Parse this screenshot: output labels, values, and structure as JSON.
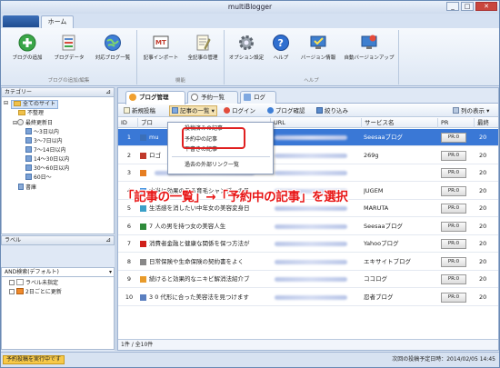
{
  "window": {
    "title": "multiBlogger",
    "minimize": "_",
    "maximize": "□",
    "close": "✕"
  },
  "ribbon": {
    "home_tab": "ホーム",
    "groups": [
      {
        "label": "ブログの追加/編集",
        "buttons": [
          "ブログの追加",
          "ブログデータ",
          "対応ブログ一覧"
        ]
      },
      {
        "label": "機能",
        "buttons": [
          "記事インポート",
          "全記事の管理"
        ]
      },
      {
        "label": "ヘルプ",
        "buttons": [
          "オプション設定",
          "ヘルプ",
          "バージョン情報",
          "自動バージョンアップ"
        ]
      }
    ]
  },
  "category_panel": {
    "header": "カテゴリー",
    "root": "全てのサイト",
    "items": [
      "不整理",
      "最終更新日",
      "～3日以内",
      "3～7日以内",
      "7～14日以内",
      "14～30日以内",
      "30～60日以内",
      "60日～",
      "書庫"
    ]
  },
  "label_panel": {
    "header": "ラベル",
    "mode": "AND検索(デフォルト)",
    "items": [
      "ラベル未指定",
      "2日ごとに更新"
    ]
  },
  "tabs": [
    "ブログ管理",
    "予約一覧",
    "ログ"
  ],
  "toolbar": {
    "new_post": "新規投稿",
    "post_list": "記事の一覧",
    "login": "ログイン",
    "blog_confirm": "ブログ確認",
    "filter": "絞り込み",
    "columns": "列の表示"
  },
  "table": {
    "headers": [
      "ID",
      "ブロ",
      "URL",
      "サービス名",
      "PR",
      "最終"
    ],
    "rows": [
      {
        "id": "1",
        "title": "mu",
        "service": "Seesaaブログ",
        "pr": "PR:0",
        "last": "20"
      },
      {
        "id": "2",
        "title": "ロゴ",
        "service": "269g",
        "pr": "PR:0",
        "last": "20"
      },
      {
        "id": "3",
        "title": "",
        "service": "",
        "pr": "PR:0",
        "last": "20"
      },
      {
        "id": "4",
        "title": "本当に効果のある育毛シャンプーの見",
        "service": "JUGEM",
        "pr": "PR:0",
        "last": "20"
      },
      {
        "id": "5",
        "title": "生活感を消したい中年女の美容変身日",
        "service": "MARUTA",
        "pr": "PR:0",
        "last": "20"
      },
      {
        "id": "6",
        "title": "7 人の男を持つ女の美容人生",
        "service": "Seesaaブログ",
        "pr": "PR:0",
        "last": "20"
      },
      {
        "id": "7",
        "title": "消費者金融と健康な関係を保つ方法が",
        "service": "Yahooブログ",
        "pr": "PR:0",
        "last": "20"
      },
      {
        "id": "8",
        "title": "日常保険や生命保険の契約書をよく",
        "service": "エキサイトブログ",
        "pr": "PR:0",
        "last": "20"
      },
      {
        "id": "9",
        "title": "続けると効果的なニキビ解消法紹介ブ",
        "service": "ココログ",
        "pr": "PR:0",
        "last": "20"
      },
      {
        "id": "10",
        "title": "3 0 代形に合った美容法を見つけます",
        "service": "忍者ブログ",
        "pr": "PR:0",
        "last": "20"
      }
    ]
  },
  "row_status": "1件 / 全10件",
  "dropdown": {
    "items": [
      "投稿済みの記事",
      "予約中の記事",
      "下書きの記事",
      "過去の外部リンク一覧"
    ]
  },
  "annotation": "「記事の一覧」→「予約中の記事」を選択",
  "statusbar": {
    "left": "予約投稿を実行中です",
    "right": "次回の投稿予定日時：2014/02/05 14:45"
  }
}
